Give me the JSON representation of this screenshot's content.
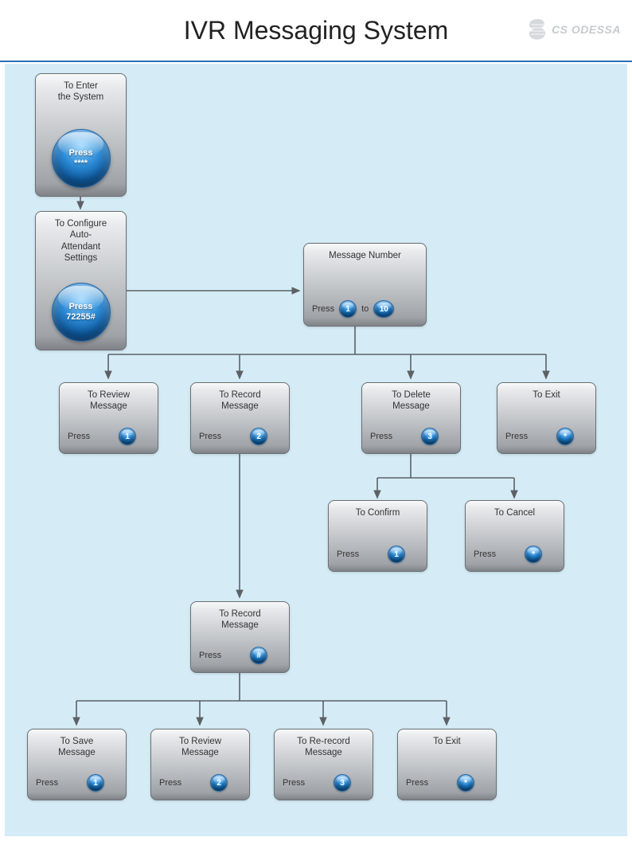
{
  "header": {
    "title": "IVR Messaging System",
    "logo_text": "CS ODESSA"
  },
  "nodes": {
    "enter": {
      "title": "To Enter\nthe System",
      "big_btn_label": "Press",
      "big_btn_value": "****"
    },
    "config": {
      "title": "To Configure\nAuto-\nAttendant\nSettings",
      "big_btn_label": "Press",
      "big_btn_value": "72255#"
    },
    "msgnum": {
      "title": "Message Number",
      "press_label": "Press",
      "key1": "1",
      "to_label": "to",
      "key2": "10"
    },
    "review1": {
      "title": "To Review\nMessage",
      "press_label": "Press",
      "key": "1"
    },
    "record1": {
      "title": "To Record\nMessage",
      "press_label": "Press",
      "key": "2"
    },
    "delete1": {
      "title": "To Delete\nMessage",
      "press_label": "Press",
      "key": "3"
    },
    "exit1": {
      "title": "To Exit",
      "press_label": "Press",
      "key": "*"
    },
    "confirm": {
      "title": "To Confirm",
      "press_label": "Press",
      "key": "1"
    },
    "cancel": {
      "title": "To Cancel",
      "press_label": "Press",
      "key": "*"
    },
    "record2": {
      "title": "To Record\nMessage",
      "press_label": "Press",
      "key": "#"
    },
    "save": {
      "title": "To Save\nMessage",
      "press_label": "Press",
      "key": "1"
    },
    "review2": {
      "title": "To Review\nMessage",
      "press_label": "Press",
      "key": "2"
    },
    "rerecord": {
      "title": "To Re-record\nMessage",
      "press_label": "Press",
      "key": "3"
    },
    "exit2": {
      "title": "To Exit",
      "press_label": "Press",
      "key": "*"
    }
  }
}
